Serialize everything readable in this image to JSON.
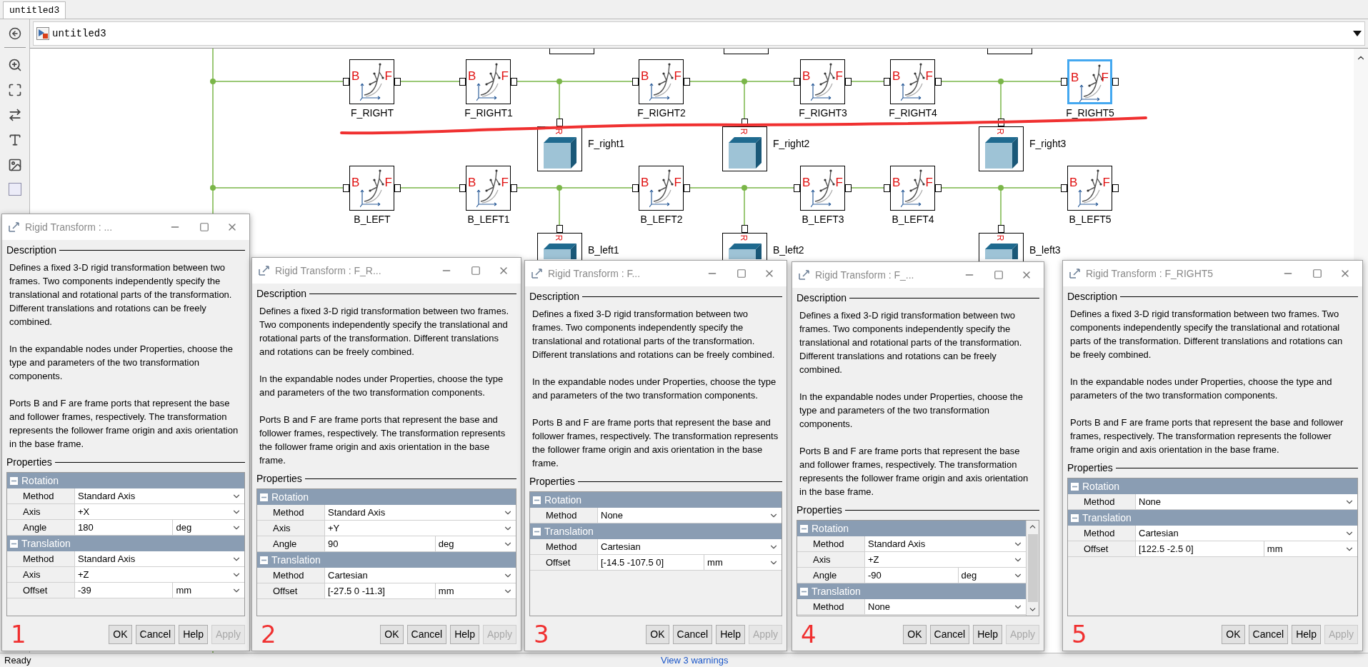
{
  "tabs": [
    {
      "label": "untitled3",
      "selected": true
    }
  ],
  "address_bar": {
    "path": "untitled3"
  },
  "diagram": {
    "rows": [
      {
        "blocks": [
          {
            "label": "F_RIGHT",
            "selected": false,
            "base_port": "B",
            "follower_port": "F"
          },
          {
            "label": "F_RIGHT1",
            "selected": false,
            "base_port": "B",
            "follower_port": "F"
          },
          {
            "label": "F_RIGHT2",
            "selected": false,
            "base_port": "B",
            "follower_port": "F"
          },
          {
            "label": "F_RIGHT3",
            "selected": false,
            "base_port": "B",
            "follower_port": "F"
          },
          {
            "label": "F_RIGHT4",
            "selected": false,
            "base_port": "B",
            "follower_port": "F"
          },
          {
            "label": "F_RIGHT5",
            "selected": true,
            "base_port": "B",
            "follower_port": "F"
          }
        ],
        "solids": [
          {
            "label": "F_right1",
            "port": "R"
          },
          {
            "label": "F_right2",
            "port": "R"
          },
          {
            "label": "F_right3",
            "port": "R"
          }
        ]
      },
      {
        "blocks": [
          {
            "label": "B_LEFT",
            "selected": false,
            "base_port": "B",
            "follower_port": "F"
          },
          {
            "label": "B_LEFT1",
            "selected": false,
            "base_port": "B",
            "follower_port": "F"
          },
          {
            "label": "B_LEFT2",
            "selected": false,
            "base_port": "B",
            "follower_port": "F"
          },
          {
            "label": "B_LEFT3",
            "selected": false,
            "base_port": "B",
            "follower_port": "F"
          },
          {
            "label": "B_LEFT4",
            "selected": false,
            "base_port": "B",
            "follower_port": "F"
          },
          {
            "label": "B_LEFT5",
            "selected": false,
            "base_port": "B",
            "follower_port": "F"
          }
        ],
        "solids": [
          {
            "label": "B_left1",
            "port": "R"
          },
          {
            "label": "B_left2",
            "port": "R"
          },
          {
            "label": "B_left3",
            "port": "R"
          }
        ]
      }
    ]
  },
  "dialogs": [
    {
      "title": "Rigid Transform : ...",
      "description_heading": "Description",
      "description": [
        "Defines a fixed 3-D rigid transformation between two frames. Two components independently specify the translational and rotational parts of the transformation. Different translations and rotations can be freely combined.",
        "In the expandable nodes under Properties, choose the type and parameters of the two transformation components.",
        "Ports B and F are frame ports that represent the base and follower frames, respectively. The transformation represents the follower frame origin and axis orientation in the base frame."
      ],
      "properties_heading": "Properties",
      "scrollable": false,
      "groups": [
        {
          "title": "Rotation",
          "expanded": true,
          "rows": [
            {
              "kind": "select",
              "label": "Method",
              "value": "Standard Axis"
            },
            {
              "kind": "select",
              "label": "Axis",
              "value": "+X"
            },
            {
              "kind": "quantity",
              "label": "Angle",
              "value": "180",
              "unit": "deg"
            }
          ]
        },
        {
          "title": "Translation",
          "expanded": true,
          "rows": [
            {
              "kind": "select",
              "label": "Method",
              "value": "Standard Axis"
            },
            {
              "kind": "select",
              "label": "Axis",
              "value": "+Z"
            },
            {
              "kind": "quantity",
              "label": "Offset",
              "value": "-39",
              "unit": "mm"
            }
          ]
        }
      ],
      "buttons": [
        {
          "label": "OK",
          "disabled": false
        },
        {
          "label": "Cancel",
          "disabled": false
        },
        {
          "label": "Help",
          "disabled": false
        },
        {
          "label": "Apply",
          "disabled": true
        }
      ],
      "annotation": "1"
    },
    {
      "title": "Rigid Transform : F_R...",
      "description_heading": "Description",
      "description": [
        "Defines a fixed 3-D rigid transformation between two frames. Two components independently specify the translational and rotational parts of the transformation. Different translations and rotations can be freely combined.",
        "In the expandable nodes under Properties, choose the type and parameters of the two transformation components.",
        "Ports B and F are frame ports that represent the base and follower frames, respectively. The transformation represents the follower frame origin and axis orientation in the base frame."
      ],
      "properties_heading": "Properties",
      "scrollable": false,
      "groups": [
        {
          "title": "Rotation",
          "expanded": true,
          "rows": [
            {
              "kind": "select",
              "label": "Method",
              "value": "Standard Axis"
            },
            {
              "kind": "select",
              "label": "Axis",
              "value": "+Y"
            },
            {
              "kind": "quantity",
              "label": "Angle",
              "value": "90",
              "unit": "deg"
            }
          ]
        },
        {
          "title": "Translation",
          "expanded": true,
          "rows": [
            {
              "kind": "select",
              "label": "Method",
              "value": "Cartesian"
            },
            {
              "kind": "quantity",
              "label": "Offset",
              "value": "[-27.5 0 -11.3]",
              "unit": "mm"
            }
          ]
        }
      ],
      "buttons": [
        {
          "label": "OK",
          "disabled": false
        },
        {
          "label": "Cancel",
          "disabled": false
        },
        {
          "label": "Help",
          "disabled": false
        },
        {
          "label": "Apply",
          "disabled": true
        }
      ],
      "annotation": "2"
    },
    {
      "title": "Rigid Transform : F...",
      "description_heading": "Description",
      "description": [
        "Defines a fixed 3-D rigid transformation between two frames. Two components independently specify the translational and rotational parts of the transformation. Different translations and rotations can be freely combined.",
        "In the expandable nodes under Properties, choose the type and parameters of the two transformation components.",
        "Ports B and F are frame ports that represent the base and follower frames, respectively. The transformation represents the follower frame origin and axis orientation in the base frame."
      ],
      "properties_heading": "Properties",
      "scrollable": false,
      "groups": [
        {
          "title": "Rotation",
          "expanded": true,
          "rows": [
            {
              "kind": "select",
              "label": "Method",
              "value": "None"
            }
          ]
        },
        {
          "title": "Translation",
          "expanded": true,
          "rows": [
            {
              "kind": "select",
              "label": "Method",
              "value": "Cartesian"
            },
            {
              "kind": "quantity",
              "label": "Offset",
              "value": "[-14.5 -107.5 0]",
              "unit": "mm"
            }
          ]
        }
      ],
      "buttons": [
        {
          "label": "OK",
          "disabled": false
        },
        {
          "label": "Cancel",
          "disabled": false
        },
        {
          "label": "Help",
          "disabled": false
        },
        {
          "label": "Apply",
          "disabled": true
        }
      ],
      "annotation": "3"
    },
    {
      "title": "Rigid Transform : F_...",
      "description_heading": "Description",
      "description": [
        "Defines a fixed 3-D rigid transformation between two frames. Two components independently specify the translational and rotational parts of the transformation. Different translations and rotations can be freely combined.",
        "In the expandable nodes under Properties, choose the type and parameters of the two transformation components.",
        "Ports B and F are frame ports that represent the base and follower frames, respectively. The transformation represents the follower frame origin and axis orientation in the base frame."
      ],
      "properties_heading": "Properties",
      "scrollable": true,
      "groups": [
        {
          "title": "Rotation",
          "expanded": true,
          "rows": [
            {
              "kind": "select",
              "label": "Method",
              "value": "Standard Axis"
            },
            {
              "kind": "select",
              "label": "Axis",
              "value": "+Z"
            },
            {
              "kind": "quantity",
              "label": "Angle",
              "value": "-90",
              "unit": "deg"
            }
          ]
        },
        {
          "title": "Translation",
          "expanded": true,
          "rows": [
            {
              "kind": "select",
              "label": "Method",
              "value": "None"
            }
          ]
        }
      ],
      "buttons": [
        {
          "label": "OK",
          "disabled": false
        },
        {
          "label": "Cancel",
          "disabled": false
        },
        {
          "label": "Help",
          "disabled": false
        },
        {
          "label": "Apply",
          "disabled": true
        }
      ],
      "annotation": "4"
    },
    {
      "title": "Rigid Transform : F_RIGHT5",
      "description_heading": "Description",
      "description": [
        "Defines a fixed 3-D rigid transformation between two frames. Two components independently specify the translational and rotational parts of the transformation. Different translations and rotations can be freely combined.",
        "In the expandable nodes under Properties, choose the type and parameters of the two transformation components.",
        "Ports B and F are frame ports that represent the base and follower frames, respectively. The transformation represents the follower frame origin and axis orientation in the base frame."
      ],
      "properties_heading": "Properties",
      "scrollable": false,
      "groups": [
        {
          "title": "Rotation",
          "expanded": true,
          "rows": [
            {
              "kind": "select",
              "label": "Method",
              "value": "None"
            }
          ]
        },
        {
          "title": "Translation",
          "expanded": true,
          "rows": [
            {
              "kind": "select",
              "label": "Method",
              "value": "Cartesian"
            },
            {
              "kind": "quantity",
              "label": "Offset",
              "value": "[122.5 -2.5 0]",
              "unit": "mm"
            }
          ]
        }
      ],
      "buttons": [
        {
          "label": "OK",
          "disabled": false
        },
        {
          "label": "Cancel",
          "disabled": false
        },
        {
          "label": "Help",
          "disabled": false
        },
        {
          "label": "Apply",
          "disabled": true
        }
      ],
      "annotation": "5"
    }
  ],
  "status_bar": {
    "status": "Ready",
    "link": "View 3 warnings"
  }
}
